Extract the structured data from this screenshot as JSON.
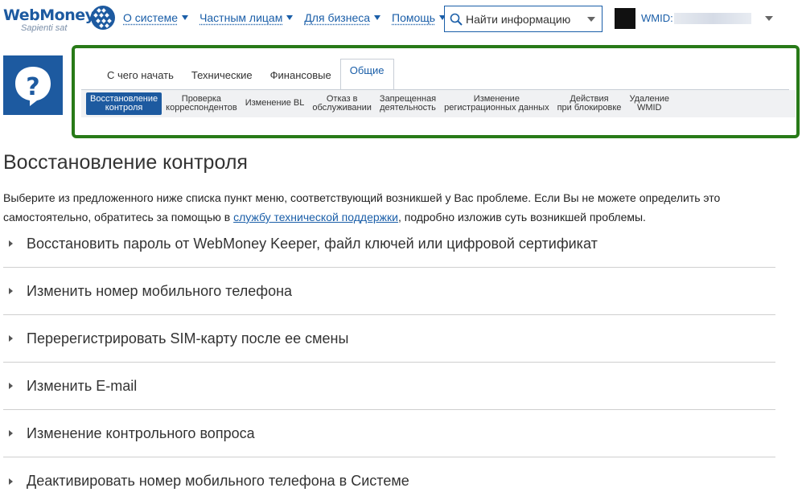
{
  "header": {
    "logo_text": "WebMoney",
    "logo_sub": "Sapienti sat",
    "nav": [
      "О системе",
      "Частным лицам",
      "Для бизнеса",
      "Помощь"
    ],
    "search_placeholder": "Найти информацию",
    "wmid_label": "WMID:"
  },
  "tabs": [
    {
      "label": "С чего начать",
      "active": false
    },
    {
      "label": "Технические",
      "active": false
    },
    {
      "label": "Финансовые",
      "active": false
    },
    {
      "label": "Общие",
      "active": true
    }
  ],
  "subnav": [
    {
      "label": "Восстановление\nконтроля",
      "active": true
    },
    {
      "label": "Проверка\nкорреспондентов",
      "active": false
    },
    {
      "label": "Изменение BL",
      "active": false
    },
    {
      "label": "Отказ в\nобслуживании",
      "active": false
    },
    {
      "label": "Запрещенная\nдеятельность",
      "active": false
    },
    {
      "label": "Изменение\nрегистрационных данных",
      "active": false
    },
    {
      "label": "Действия\nпри блокировке",
      "active": false
    },
    {
      "label": "Удаление\nWMID",
      "active": false
    }
  ],
  "content": {
    "title": "Восстановление контроля",
    "intro_before": "Выберите из предложенного ниже списка пункт меню, соответствующий возникшей у Вас проблеме. Если Вы не можете определить это самостоятельно, обратитесь за помощью в ",
    "intro_link": "службу технической поддержки",
    "intro_after": ", подробно изложив суть возникшей проблемы.",
    "items": [
      "Восстановить пароль от WebMoney Keeper, файл ключей или цифровой сертификат",
      "Изменить номер мобильного телефона",
      "Перерегистрировать SIM-карту после ее смены",
      "Изменить E-mail",
      "Изменение контрольного вопроса",
      "Деактивировать номер мобильного телефона в Системе"
    ]
  },
  "colors": {
    "brand_blue": "#1d5aa0",
    "link_blue": "#1a5ea8",
    "highlight_green": "#287a18"
  }
}
